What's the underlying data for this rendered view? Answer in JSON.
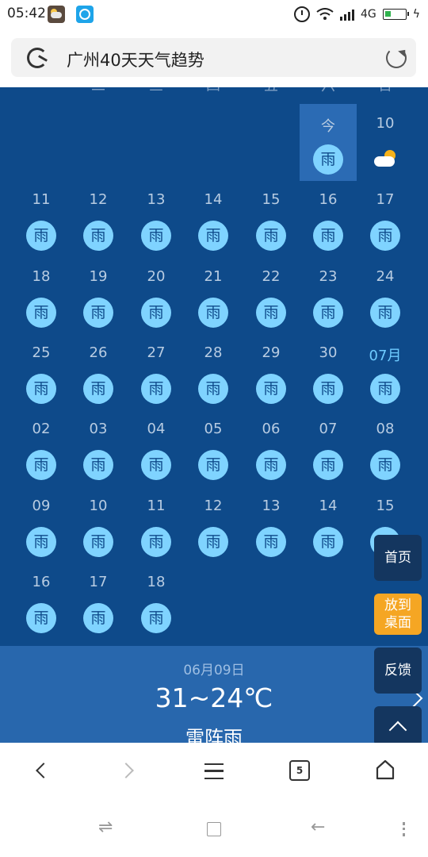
{
  "status_bar": {
    "time": "05:42",
    "network": "4G",
    "icons": [
      "weather-app-icon",
      "clock-app-icon",
      "alarm-icon",
      "wifi-icon",
      "signal-icon",
      "battery-icon"
    ]
  },
  "search": {
    "query": "广州40天天气趋势"
  },
  "calendar": {
    "weekdays": [
      "一",
      "二",
      "三",
      "四",
      "五",
      "六",
      "日"
    ],
    "today_label": "今",
    "rain_label": "雨",
    "month_label": "07月",
    "day_10": "10",
    "week_2": [
      "11",
      "12",
      "13",
      "14",
      "15",
      "16",
      "17"
    ],
    "week_3": [
      "18",
      "19",
      "20",
      "21",
      "22",
      "23",
      "24"
    ],
    "week_4": [
      "25",
      "26",
      "27",
      "28",
      "29",
      "30"
    ],
    "week_5": [
      "02",
      "03",
      "04",
      "05",
      "06",
      "07",
      "08"
    ],
    "week_6": [
      "09",
      "10",
      "11",
      "12",
      "13",
      "14",
      "15"
    ],
    "week_7": [
      "16",
      "17",
      "18"
    ],
    "colors": {
      "background": "#0e4a8a",
      "today_highlight": "#2b6bb4",
      "rain_badge": "#7fd3ff",
      "month_label": "#6ecbff"
    }
  },
  "detail": {
    "date": "06月09日",
    "temperature": "31~24℃",
    "description": "雷阵雨"
  },
  "float_buttons": {
    "home": "首页",
    "desktop_line1": "放到",
    "desktop_line2": "桌面",
    "feedback": "反馈"
  },
  "toolbar": {
    "tab_count": "5"
  }
}
